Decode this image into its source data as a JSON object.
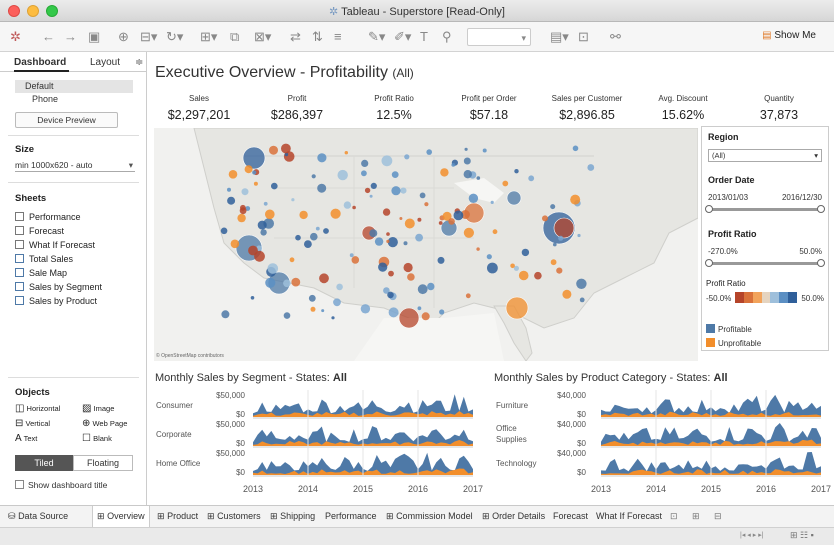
{
  "window": {
    "title": "Tableau - Superstore [Read-Only]"
  },
  "toolbar": {
    "show_me": "Show Me"
  },
  "sidebar": {
    "tabs": [
      "Dashboard",
      "Layout"
    ],
    "devices": [
      "Default",
      "Phone"
    ],
    "device_preview": "Device Preview",
    "size_title": "Size",
    "size_value": "min 1000x620 - auto",
    "sheets_title": "Sheets",
    "sheets": [
      "Performance",
      "Forecast",
      "What If Forecast",
      "Total Sales",
      "Sale Map",
      "Sales by Segment",
      "Sales by Product"
    ],
    "objects_title": "Objects",
    "objects": [
      "Horizontal",
      "Image",
      "Vertical",
      "Web Page",
      "Text",
      "Blank"
    ],
    "tiled": "Tiled",
    "floating": "Floating",
    "show_title": "Show dashboard title"
  },
  "dashboard": {
    "title_main": "Executive Overview - Profitability",
    "title_sub": "(All)",
    "kpis": [
      {
        "label": "Sales",
        "value": "$2,297,201"
      },
      {
        "label": "Profit",
        "value": "$286,397"
      },
      {
        "label": "Profit Ratio",
        "value": "12.5%"
      },
      {
        "label": "Profit per Order",
        "value": "$57.18"
      },
      {
        "label": "Sales per Customer",
        "value": "$2,896.85"
      },
      {
        "label": "Avg. Discount",
        "value": "15.62%"
      },
      {
        "label": "Quantity",
        "value": "37,873"
      }
    ],
    "map_credit": "© OpenStreetMap contributors",
    "filters": {
      "region_title": "Region",
      "region_value": "(All)",
      "order_date_title": "Order Date",
      "date_start": "2013/01/03",
      "date_end": "2016/12/30",
      "profit_ratio_title": "Profit Ratio",
      "pr_min": "-270.0%",
      "pr_max": "50.0%",
      "legend_title": "Profit Ratio",
      "legend_min": "-50.0%",
      "legend_max": "50.0%",
      "profitable": "Profitable",
      "unprofitable": "Unprofitable",
      "profitable_color": "#4e79a7",
      "unprofitable_color": "#f28e2b"
    },
    "segment_title": "Monthly Sales by Segment - States: ",
    "segment_states": "All",
    "product_title": "Monthly Sales by Product Category - States: ",
    "product_states": "All",
    "segment_rows": [
      {
        "label": "Consumer",
        "axis": [
          "$50,000",
          "$0"
        ]
      },
      {
        "label": "Corporate",
        "axis": [
          "$50,000",
          "$0"
        ]
      },
      {
        "label": "Home Office",
        "axis": [
          "$50,000",
          "$0"
        ]
      }
    ],
    "product_rows": [
      {
        "label": "Furniture",
        "axis": [
          "$40,000",
          "$0"
        ]
      },
      {
        "label": "Office Supplies",
        "axis": [
          "$40,000",
          "$0"
        ]
      },
      {
        "label": "Technology",
        "axis": [
          "$40,000",
          "$0"
        ]
      }
    ],
    "years": [
      "2013",
      "2014",
      "2015",
      "2016",
      "2017"
    ]
  },
  "tabs": [
    "Data Source",
    "Overview",
    "Product",
    "Customers",
    "Shipping",
    "Performance",
    "Commission Model",
    "Order Details",
    "Forecast",
    "What If Forecast"
  ]
}
